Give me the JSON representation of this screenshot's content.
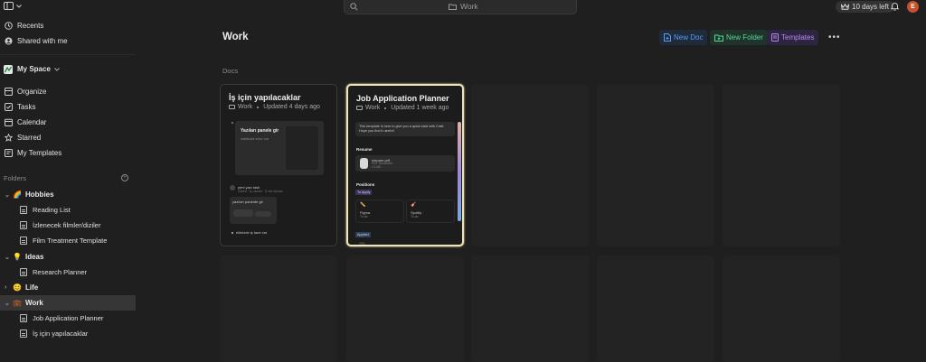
{
  "search": {
    "crumb": "Work"
  },
  "trial": {
    "label": "10 days left"
  },
  "user": {
    "initial": "E",
    "color": "#c8502c"
  },
  "sidebar": {
    "top_items": [
      {
        "label": "Recents",
        "icon": "clock-icon"
      },
      {
        "label": "Shared with me",
        "icon": "people-icon"
      }
    ],
    "space": {
      "label": "My Space"
    },
    "nav_items": [
      {
        "label": "Organize",
        "icon": "organize-icon"
      },
      {
        "label": "Tasks",
        "icon": "checkbox-icon"
      },
      {
        "label": "Calendar",
        "icon": "calendar-icon"
      },
      {
        "label": "Starred",
        "icon": "star-icon"
      },
      {
        "label": "My Templates",
        "icon": "template-icon"
      }
    ],
    "folders_label": "Folders",
    "folders": [
      {
        "label": "Hobbies",
        "emoji": "🌈",
        "expanded": true,
        "docs": [
          "Reading List",
          "İzlenecek filmler/diziler",
          "Film Treatment Template"
        ]
      },
      {
        "label": "Ideas",
        "emoji": "💡",
        "expanded": true,
        "docs": [
          "Research Planner"
        ]
      },
      {
        "label": "Life",
        "emoji": "😊",
        "expanded": false,
        "docs": []
      },
      {
        "label": "Work",
        "emoji": "💼",
        "expanded": true,
        "selected": true,
        "docs": [
          "Job Application Planner",
          "İş için yapılacaklar"
        ]
      }
    ]
  },
  "main": {
    "title": "Work",
    "buttons": {
      "new_doc": "New Doc",
      "new_folder": "New Folder",
      "templates": "Templates"
    },
    "section": "Docs",
    "cards": [
      {
        "title": "İş için yapılacaklar",
        "folder": "Work",
        "updated": "Updated 4 days ago",
        "preview": {
          "hero_title": "Yazıları panele gir",
          "hero_sub": "dakikalık süre var",
          "task": "yeni yazı task",
          "task_sub": "Görevi · İş, durum · 5 min okuma",
          "box_title": "yazıları panelde gir",
          "bullet": "elimizde iş tane var"
        }
      },
      {
        "title": "Job Application Planner",
        "folder": "Work",
        "updated": "Updated 1 week ago",
        "preview": {
          "intro": "This template is here to give you a quick start with Craft. Hope you find it useful!",
          "resume_heading": "Resume",
          "resume_file": "resume.pdf",
          "resume_meta": "PDF Document",
          "resume_size": "1.1 kB",
          "positions_heading": "Positions",
          "to_apply": "To Apply",
          "pos1": "Figma",
          "pos2": "Spotify",
          "pos_sub": "To-do",
          "applied": "Applied"
        }
      }
    ]
  }
}
